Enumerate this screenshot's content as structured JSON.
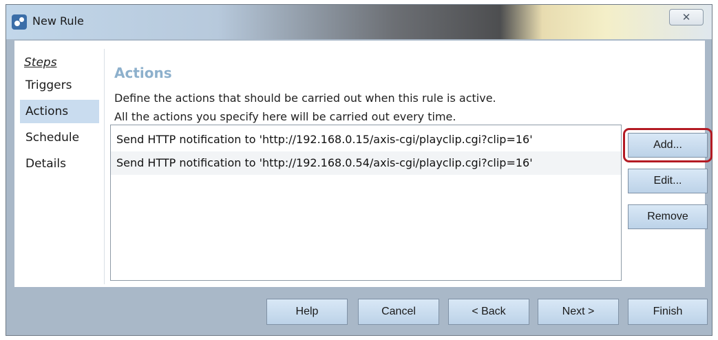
{
  "window": {
    "title": "New Rule",
    "close_label": "✕"
  },
  "steps": {
    "title": "Steps",
    "items": [
      "Triggers",
      "Actions",
      "Schedule",
      "Details"
    ],
    "active": "Actions"
  },
  "main": {
    "heading": "Actions",
    "description_line1": "Define the actions that should be carried out when this rule is active.",
    "description_line2": "All the actions you specify here will be carried out every time.",
    "actions": [
      "Send HTTP notification to 'http://192.168.0.15/axis-cgi/playclip.cgi?clip=16'",
      "Send HTTP notification to 'http://192.168.0.54/axis-cgi/playclip.cgi?clip=16'"
    ]
  },
  "side_buttons": {
    "add": "Add...",
    "edit": "Edit...",
    "remove": "Remove"
  },
  "footer": {
    "help": "Help",
    "cancel": "Cancel",
    "back": "< Back",
    "next": "Next >",
    "finish": "Finish"
  },
  "colors": {
    "heading": "#8db0cc",
    "selection": "#c9dcef",
    "highlight": "#b41b24",
    "button_top": "#d9e8f6",
    "button_bottom": "#bcd2e8"
  },
  "icons": {
    "app": "app-gears-icon",
    "close": "close-icon"
  }
}
